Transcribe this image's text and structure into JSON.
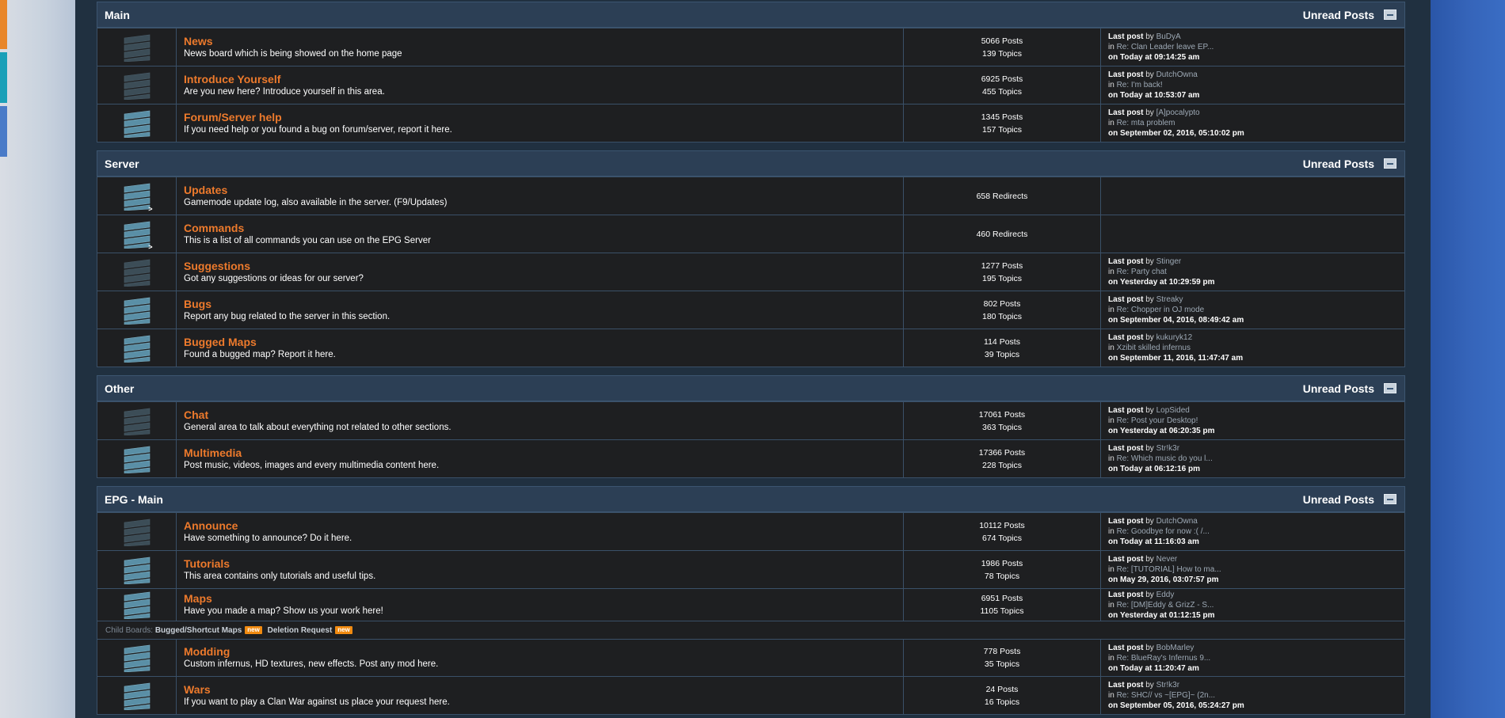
{
  "colors": {
    "board_link": "#ed7a2c",
    "board_icon_active": "#5a8fa6",
    "board_icon_inactive": "#3c4d57",
    "new_badge": "#f08a10"
  },
  "categories": [
    {
      "title": "Main",
      "unread": "Unread Posts",
      "boards": [
        {
          "name": "News",
          "desc": "News board which is being showed on the home page",
          "posts": "5066 Posts",
          "topics": "139 Topics",
          "icon": "board-read-icon",
          "last": {
            "lp": "Last post",
            "by": "by",
            "user": "BuDyA",
            "in": "in",
            "topic": "Re: Clan Leader leave EP...",
            "on": "on",
            "when": "Today at 09:14:25 am"
          }
        },
        {
          "name": "Introduce Yourself",
          "desc": "Are you new here? Introduce yourself in this area.",
          "posts": "6925 Posts",
          "topics": "455 Topics",
          "icon": "board-read-icon",
          "last": {
            "lp": "Last post",
            "by": "by",
            "user": "DutchOwna",
            "in": "in",
            "topic": "Re: I'm back!",
            "on": "on",
            "when": "Today at 10:53:07 am"
          }
        },
        {
          "name": "Forum/Server help",
          "desc": "If you need help or you found a bug on forum/server, report it here.",
          "posts": "1345 Posts",
          "topics": "157 Topics",
          "icon": "board-new-icon",
          "last": {
            "lp": "Last post",
            "by": "by",
            "user": "[A]pocalypto",
            "in": "in",
            "topic": "Re: mta problem",
            "on": "on",
            "when": "September 02, 2016, 05:10:02 pm"
          }
        }
      ]
    },
    {
      "title": "Server",
      "unread": "Unread Posts",
      "boards": [
        {
          "name": "Updates",
          "desc": "Gamemode update log, also available in the server. (F9/Updates)",
          "single": "658 Redirects",
          "icon": "redirect-board-icon",
          "redirect": ">"
        },
        {
          "name": "Commands",
          "desc": "This is a list of all commands you can use on the EPG Server",
          "single": "460 Redirects",
          "icon": "redirect-board-icon",
          "redirect": ">"
        },
        {
          "name": "Suggestions",
          "desc": "Got any suggestions or ideas for our server?",
          "posts": "1277 Posts",
          "topics": "195 Topics",
          "icon": "board-read-icon",
          "last": {
            "lp": "Last post",
            "by": "by",
            "user": "Stinger",
            "in": "in",
            "topic": "Re: Party chat",
            "on": "on",
            "when": "Yesterday at 10:29:59 pm"
          }
        },
        {
          "name": "Bugs",
          "desc": "Report any bug related to the server in this section.",
          "posts": "802 Posts",
          "topics": "180 Topics",
          "icon": "board-new-icon",
          "last": {
            "lp": "Last post",
            "by": "by",
            "user": "Streaky",
            "in": "in",
            "topic": "Re: Chopper in OJ mode",
            "on": "on",
            "when": "September 04, 2016, 08:49:42 am"
          }
        },
        {
          "name": "Bugged Maps",
          "desc": "Found a bugged map? Report it here.",
          "posts": "114 Posts",
          "topics": "39 Topics",
          "icon": "board-new-icon",
          "last": {
            "lp": "Last post",
            "by": "by",
            "user": "kukuryk12",
            "in": "in",
            "topic": "Xzibit skilled infernus",
            "on": "on",
            "when": "September 11, 2016, 11:47:47 am"
          }
        }
      ]
    },
    {
      "title": "Other",
      "unread": "Unread Posts",
      "boards": [
        {
          "name": "Chat",
          "desc": "General area to talk about everything not related to other sections.",
          "posts": "17061 Posts",
          "topics": "363 Topics",
          "icon": "board-read-icon",
          "last": {
            "lp": "Last post",
            "by": "by",
            "user": "LopSided",
            "in": "in",
            "topic": "Re: Post your Desktop!",
            "on": "on",
            "when": "Yesterday at 06:20:35 pm"
          }
        },
        {
          "name": "Multimedia",
          "desc": "Post music, videos, images and every multimedia content here.",
          "posts": "17366 Posts",
          "topics": "228 Topics",
          "icon": "board-new-icon",
          "last": {
            "lp": "Last post",
            "by": "by",
            "user": "Str!k3r",
            "in": "in",
            "topic": "Re: Which music do you l...",
            "on": "on",
            "when": "Today at 06:12:16 pm"
          }
        }
      ]
    },
    {
      "title": "EPG - Main",
      "unread": "Unread Posts",
      "boards": [
        {
          "name": "Announce",
          "desc": "Have something to announce? Do it here.",
          "posts": "10112 Posts",
          "topics": "674 Topics",
          "icon": "board-read-icon",
          "last": {
            "lp": "Last post",
            "by": "by",
            "user": "DutchOwna",
            "in": "in",
            "topic": "Re: Goodbye for now :( /...",
            "on": "on",
            "when": "Today at 11:16:03 am"
          }
        },
        {
          "name": "Tutorials",
          "desc": "This area contains only tutorials and useful tips.",
          "posts": "1986 Posts",
          "topics": "78 Topics",
          "icon": "board-new-icon",
          "last": {
            "lp": "Last post",
            "by": "by",
            "user": "Never",
            "in": "in",
            "topic": "Re: [TUTORIAL] How to ma...",
            "on": "on",
            "when": "May 29, 2016, 03:07:57 pm"
          }
        },
        {
          "name": "Maps",
          "desc": "Have you made a map? Show us your work here!",
          "posts": "6951 Posts",
          "topics": "1105 Topics",
          "icon": "board-new-icon",
          "last": {
            "lp": "Last post",
            "by": "by",
            "user": "Eddy",
            "in": "in",
            "topic": "Re: [DM]Eddy & GrizZ - S...",
            "on": "on",
            "when": "Yesterday at 01:12:15 pm"
          },
          "children": {
            "label": "Child Boards:",
            "items": [
              {
                "name": "Bugged/Shortcut Maps",
                "badge": "new"
              },
              {
                "name": "Deletion Request",
                "badge": "new"
              }
            ]
          }
        },
        {
          "name": "Modding",
          "desc": "Custom infernus, HD textures, new effects. Post any mod here.",
          "posts": "778 Posts",
          "topics": "35 Topics",
          "icon": "board-new-icon",
          "last": {
            "lp": "Last post",
            "by": "by",
            "user": "BobMarley",
            "in": "in",
            "topic": "Re: BlueRay's Infernus 9...",
            "on": "on",
            "when": "Today at 11:20:47 am"
          }
        },
        {
          "name": "Wars",
          "desc": "If you want to play a Clan War against us place your request here.",
          "posts": "24 Posts",
          "topics": "16 Topics",
          "icon": "board-new-icon",
          "last": {
            "lp": "Last post",
            "by": "by",
            "user": "Str!k3r",
            "in": "in",
            "topic": "Re: SHC// vs ~[EPG]~ (2n...",
            "on": "on",
            "when": "September 05, 2016, 05:24:27 pm"
          }
        }
      ]
    }
  ]
}
